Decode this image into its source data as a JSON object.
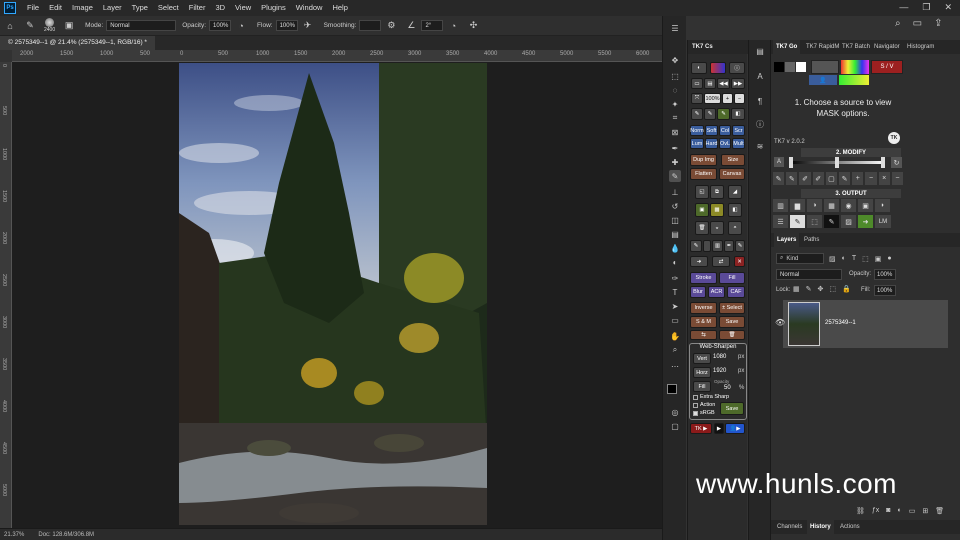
{
  "menubar": {
    "logo": "Ps",
    "items": [
      "File",
      "Edit",
      "Image",
      "Layer",
      "Type",
      "Select",
      "Filter",
      "3D",
      "View",
      "Plugins",
      "Window",
      "Help"
    ]
  },
  "options": {
    "brush_size": "2400",
    "mode_label": "Mode:",
    "mode_value": "Normal",
    "opacity_label": "Opacity:",
    "opacity_value": "100%",
    "flow_label": "Flow:",
    "flow_value": "100%",
    "smoothing_label": "Smoothing:",
    "angle_value": "2°"
  },
  "document": {
    "tab_title": "© 2575349--1 @ 21.4% (2575349--1, RGB/16) *",
    "ruler_top": [
      "2000",
      "1500",
      "1000",
      "500",
      "0",
      "500",
      "1000",
      "1500",
      "2000",
      "2500",
      "3000",
      "3500",
      "4000",
      "4500",
      "5000",
      "5500",
      "6000"
    ],
    "ruler_left": [
      "0",
      "500",
      "1000",
      "1500",
      "2000",
      "2500",
      "3000",
      "3500",
      "4000",
      "4500",
      "5000"
    ],
    "zoom": "21.37%",
    "doc_size": "Doc: 128.6M/306.8M"
  },
  "tk7": {
    "title": "TK7 Cs",
    "zoom_label": "100%",
    "row_a": [
      "Norm",
      "Soft",
      "Col",
      "Scr"
    ],
    "row_b": [
      "Lum",
      "Hard",
      "OvL",
      "Mult"
    ],
    "dup_img": "Dup Img",
    "size": "Size",
    "flatten": "Flatten",
    "canvas": "Canvas",
    "stroke": "Stroke",
    "fill": "Fill",
    "blur": "Blur",
    "acr": "ACR",
    "caf": "CAF",
    "inverse": "Inverse",
    "select": "± Select",
    "sm": "S & M",
    "save": "Save",
    "web_sharpen": "Web-Sharpen",
    "vert": "Vert",
    "vert_value": "1080",
    "horz": "Horz",
    "horz_value": "1920",
    "px": "px",
    "fill_btn": "Fill",
    "opacity_label": "Opacity",
    "opacity_value": "50",
    "percent": "%",
    "extra_sharp": "Extra Sharp",
    "action": "Action",
    "srgb": "sRGB",
    "save2": "Save",
    "tk": "TK"
  },
  "rightpanel": {
    "tabs": [
      "TK7 Go",
      "TK7 RapidM",
      "TK7 Batch",
      "Navigator",
      "Histogram"
    ],
    "sv_btn": "S / V",
    "message": "1. Choose a source to view MASK options.",
    "version": "TK7 v 2.0.2",
    "modify": "2. MODIFY",
    "output": "3. OUTPUT",
    "lm": "LM",
    "layers_tabs": [
      "Layers",
      "Paths"
    ],
    "kind": "Kind",
    "blend": "Normal",
    "opacity_label": "Opacity:",
    "opacity_value": "100%",
    "lock_label": "Lock:",
    "fill_label": "Fill:",
    "fill_value": "100%",
    "layer_name": "2575349--1",
    "bottom_tabs": [
      "Channels",
      "History",
      "Actions"
    ]
  },
  "watermark": "www.hunls.com"
}
